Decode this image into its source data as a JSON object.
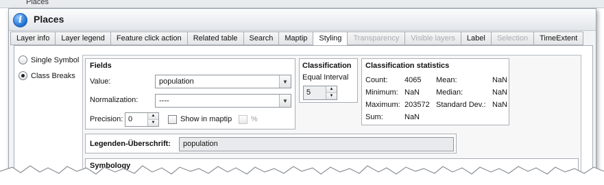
{
  "background": {
    "title": "Places"
  },
  "window": {
    "title": "Places",
    "icon": "info-icon"
  },
  "tabs": [
    {
      "label": "Layer info",
      "state": "normal"
    },
    {
      "label": "Layer legend",
      "state": "normal"
    },
    {
      "label": "Feature click action",
      "state": "normal"
    },
    {
      "label": "Related table",
      "state": "normal"
    },
    {
      "label": "Search",
      "state": "normal"
    },
    {
      "label": "Maptip",
      "state": "normal"
    },
    {
      "label": "Styling",
      "state": "active"
    },
    {
      "label": "Transparency",
      "state": "disabled"
    },
    {
      "label": "Visible layers",
      "state": "disabled"
    },
    {
      "label": "Label",
      "state": "normal"
    },
    {
      "label": "Selection",
      "state": "disabled"
    },
    {
      "label": "TimeExtent",
      "state": "normal"
    }
  ],
  "mode": {
    "options": [
      {
        "label": "Single Symbol",
        "checked": false
      },
      {
        "label": "Class Breaks",
        "checked": true
      }
    ]
  },
  "fields": {
    "title": "Fields",
    "value_label": "Value:",
    "value": "population",
    "normalization_label": "Normalization:",
    "normalization": "----",
    "precision_label": "Precision:",
    "precision": "0",
    "show_in_maptip_label": "Show in maptip",
    "percent_label": "%"
  },
  "classification": {
    "title": "Classification",
    "method": "Equal Interval",
    "classes": "5"
  },
  "statistics": {
    "title": "Classification statistics",
    "count_label": "Count:",
    "count": "4065",
    "minimum_label": "Minimum:",
    "minimum": "NaN",
    "maximum_label": "Maximum:",
    "maximum": "203572",
    "sum_label": "Sum:",
    "sum": "NaN",
    "mean_label": "Mean:",
    "mean": "NaN",
    "median_label": "Median:",
    "median": "NaN",
    "stddev_label": "Standard Dev.:",
    "stddev": "NaN"
  },
  "legend_heading": {
    "label": "Legenden-Überschrift:",
    "value": "population"
  },
  "symbology": {
    "title": "Symbology"
  },
  "colors": {
    "accent": "#1c6fd1",
    "window_bg": "#f2f3f5",
    "border": "#a8adb3"
  }
}
